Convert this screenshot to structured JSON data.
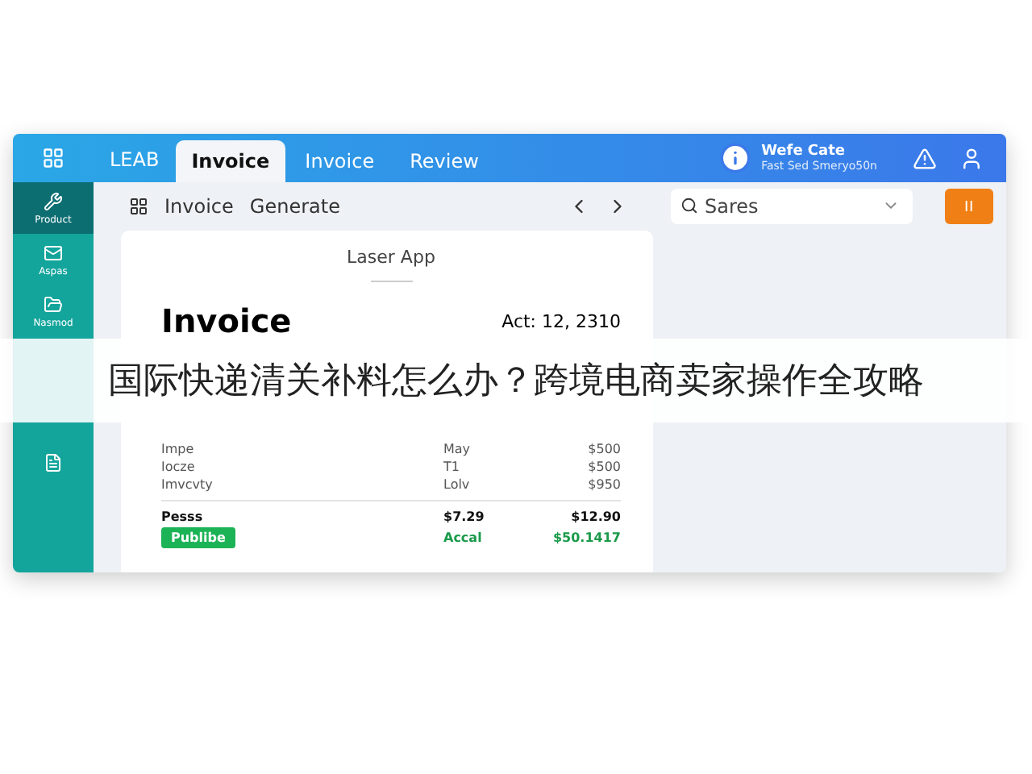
{
  "header": {
    "brand": "LEAB",
    "tabs": [
      {
        "label": "Invoice",
        "selected": true
      },
      {
        "label": "Invoice",
        "selected": false
      },
      {
        "label": "Review",
        "selected": false
      }
    ],
    "user": {
      "name": "Wefe Cate",
      "subtitle": "Fast Sed Smeryo50n"
    }
  },
  "sidebar": {
    "items": [
      {
        "label": "Product",
        "selected": true
      },
      {
        "label": "Aspas",
        "selected": false
      },
      {
        "label": "Nasmod",
        "selected": false
      }
    ]
  },
  "toolbar": {
    "crumbs": [
      "Invoice",
      "Generate"
    ],
    "search": {
      "placeholder": "Sares"
    },
    "action": "ⅠⅠ"
  },
  "invoice": {
    "app_name": "Laser App",
    "title": "Invoice",
    "date": "Act: 12, 2310",
    "rows": [
      {
        "item": "Impe",
        "qty": "May",
        "amount": "$500"
      },
      {
        "item": "Iocze",
        "qty": "T1",
        "amount": "$500"
      },
      {
        "item": "Imvcvty",
        "qty": "Lolv",
        "amount": "$950"
      }
    ],
    "total": {
      "label": "Pesss",
      "subtotal": "$7.29",
      "amount": "$12.90"
    },
    "status": {
      "badge": "Publibe",
      "label": "Accal",
      "amount": "$50.1417"
    }
  },
  "overlay_banner": "国际快递清关补料怎么办？跨境电商卖家操作全攻略"
}
